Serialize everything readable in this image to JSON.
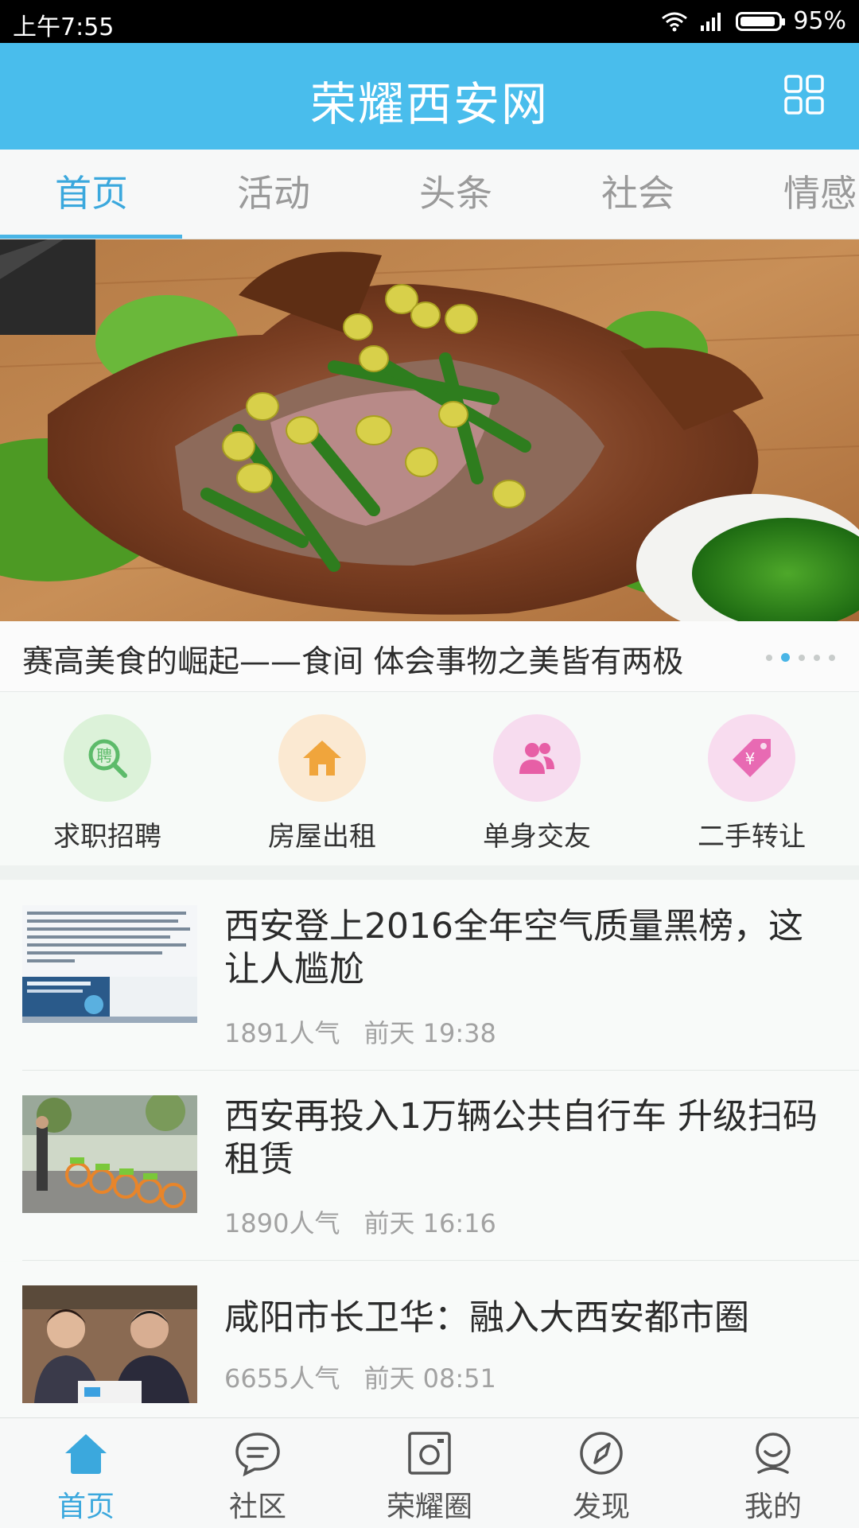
{
  "status_bar": {
    "time": "上午7:55",
    "battery": "95%"
  },
  "app_bar": {
    "title": "荣耀西安网",
    "menu_icon": "grid-menu-icon"
  },
  "tabs": [
    {
      "label": "首页",
      "active": true
    },
    {
      "label": "活动"
    },
    {
      "label": "头条"
    },
    {
      "label": "社会"
    },
    {
      "label": "情感"
    }
  ],
  "banner": {
    "caption": "赛高美食的崛起——食间 体会事物之美皆有两极",
    "slide_count": 5,
    "active_slide": 2
  },
  "quick_links": [
    {
      "label": "求职招聘",
      "icon": "recruit-icon",
      "color": "#5dbb6a"
    },
    {
      "label": "房屋出租",
      "icon": "house-icon",
      "color": "#f0a53c"
    },
    {
      "label": "单身交友",
      "icon": "people-icon",
      "color": "#e75fa6"
    },
    {
      "label": "二手转让",
      "icon": "tag-icon",
      "color": "#e86ab3"
    }
  ],
  "news": [
    {
      "title": "西安登上2016全年空气质量黑榜，这让人尴尬",
      "views": "1891人气",
      "time": "前天 19:38"
    },
    {
      "title": "西安再投入1万辆公共自行车 升级扫码租赁",
      "views": "1890人气",
      "time": "前天 16:16"
    },
    {
      "title": "咸阳市长卫华：融入大西安都市圈",
      "views": "6655人气",
      "time": "前天 08:51"
    }
  ],
  "bottom_nav": [
    {
      "label": "首页",
      "icon": "home-icon",
      "active": true
    },
    {
      "label": "社区",
      "icon": "chat-bubble-icon"
    },
    {
      "label": "荣耀圈",
      "icon": "camera-icon"
    },
    {
      "label": "发现",
      "icon": "compass-icon"
    },
    {
      "label": "我的",
      "icon": "profile-icon"
    }
  ],
  "colors": {
    "brand": "#49bdec",
    "accent": "#3ba8dd"
  }
}
